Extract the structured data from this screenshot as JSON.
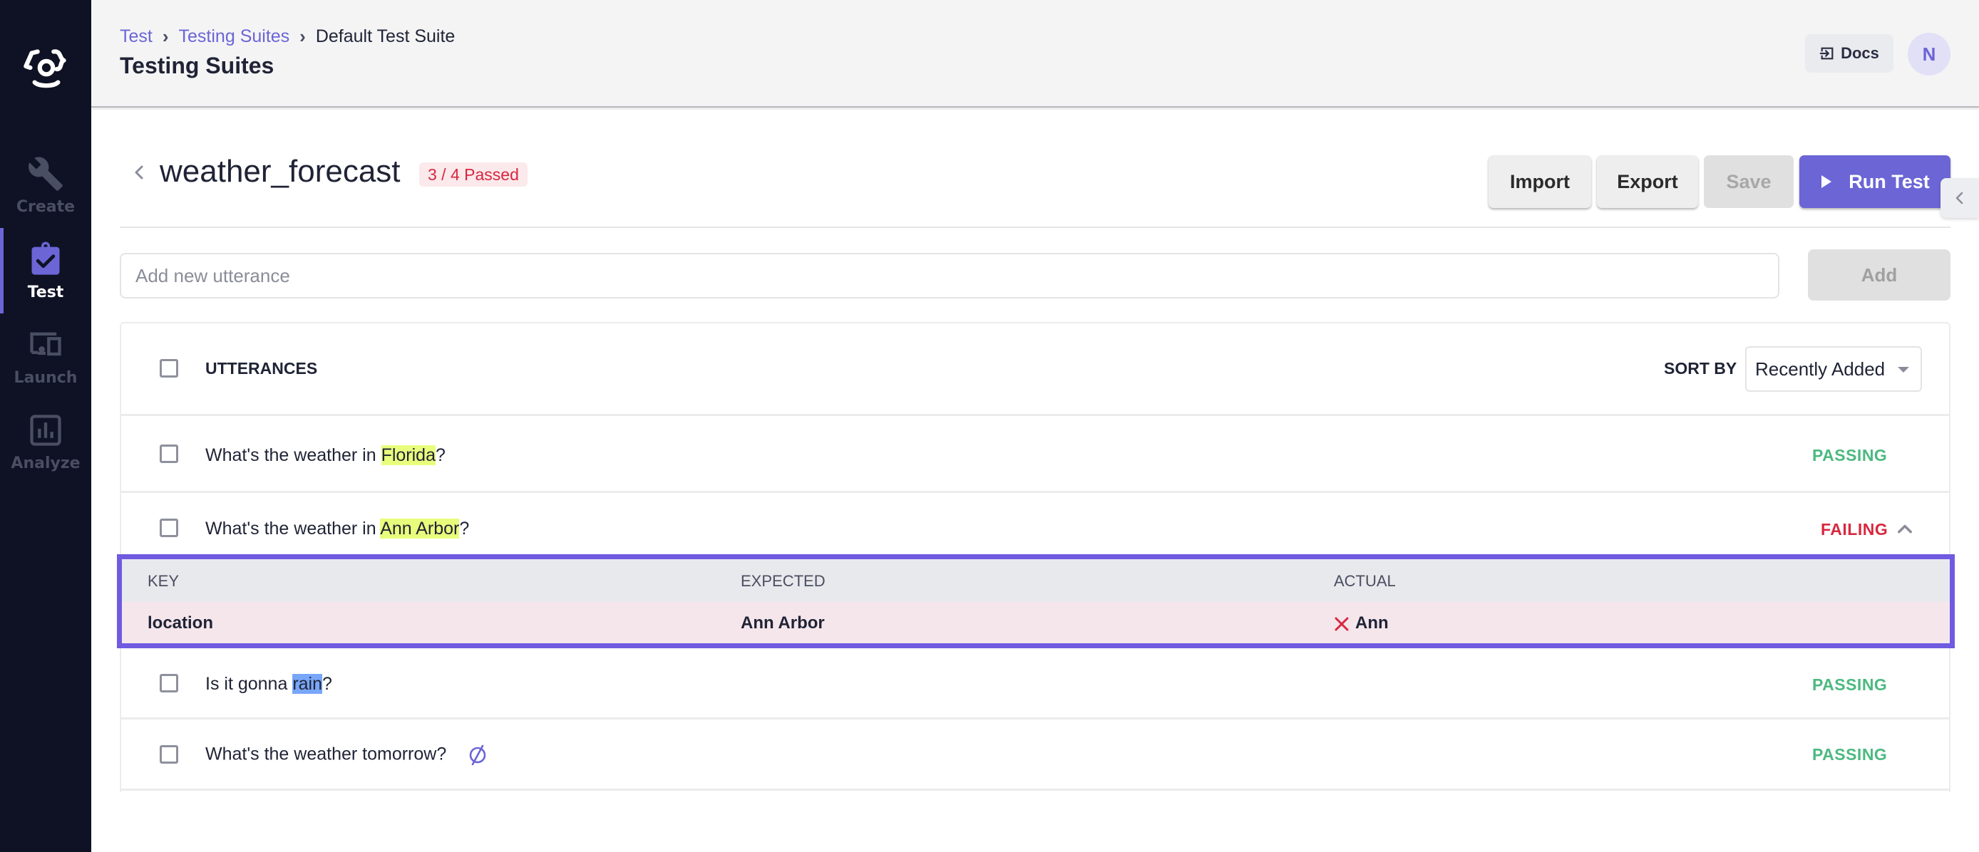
{
  "sidebar": {
    "logo": "app-logo",
    "items": [
      {
        "label": "Create",
        "icon": "wrench-icon",
        "active": false
      },
      {
        "label": "Test",
        "icon": "clipboard-check-icon",
        "active": true
      },
      {
        "label": "Launch",
        "icon": "devices-icon",
        "active": false
      },
      {
        "label": "Analyze",
        "icon": "bar-chart-icon",
        "active": false
      }
    ]
  },
  "header": {
    "breadcrumb": [
      "Test",
      "Testing Suites",
      "Default Test Suite"
    ],
    "title": "Testing Suites",
    "docs_label": "Docs",
    "avatar_initial": "N"
  },
  "suite": {
    "name": "weather_forecast",
    "badge": "3 / 4 Passed",
    "buttons": {
      "import": "Import",
      "export": "Export",
      "save": "Save",
      "run": "Run Test"
    }
  },
  "add_utterance": {
    "placeholder": "Add new utterance",
    "value": "",
    "button": "Add"
  },
  "list": {
    "header_label": "UTTERANCES",
    "sort_label": "SORT BY",
    "sort_value": "Recently Added",
    "rows": [
      {
        "prefix": "What's the weather in ",
        "entity": "Florida",
        "suffix": "?",
        "entity_color": "#e9fd7c",
        "status": "PASSING"
      },
      {
        "prefix": "What's the weather in ",
        "entity": "Ann Arbor",
        "suffix": "?",
        "entity_color": "#e9fd7c",
        "status": "FAILING",
        "expanded": true
      },
      {
        "prefix": "Is it gonna ",
        "entity": "rain",
        "suffix": "?",
        "entity_color": "#78a6f8",
        "status": "PASSING"
      },
      {
        "prefix": "What's the weather tomorrow?",
        "entity": "",
        "suffix": "",
        "status": "PASSING",
        "icon": "empty-set-icon"
      }
    ],
    "detail": {
      "columns": [
        "KEY",
        "EXPECTED",
        "ACTUAL"
      ],
      "rows": [
        {
          "key": "location",
          "expected": "Ann Arbor",
          "actual": "Ann",
          "match": false
        }
      ]
    }
  },
  "colors": {
    "accent": "#6b65d6",
    "passing": "#4cb980",
    "failing": "#d7283e",
    "highlight_border": "#6f5ae0"
  }
}
